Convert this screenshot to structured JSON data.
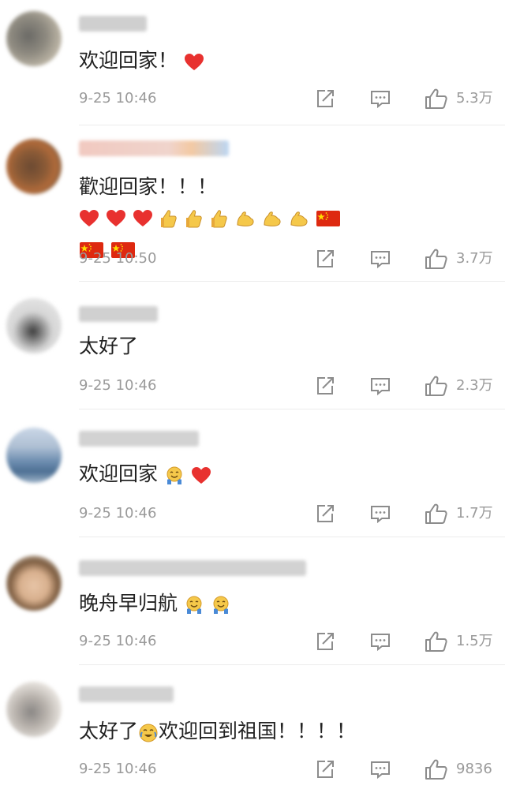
{
  "comments": [
    {
      "text": "欢迎回家！",
      "time": "9-25 10:46",
      "likes": "5.3万",
      "emoji": [
        "heart-icon"
      ]
    },
    {
      "text": "歡迎回家！！！",
      "time": "9-25 10:50",
      "likes": "3.7万",
      "emoji": [
        "heart-icon",
        "heart-icon",
        "heart-icon",
        "thumbs-up-icon",
        "thumbs-up-icon",
        "thumbs-up-icon",
        "flexed-biceps-icon",
        "flexed-biceps-icon",
        "flexed-biceps-icon",
        "china-flag-icon",
        "china-flag-icon",
        "china-flag-icon"
      ]
    },
    {
      "text": "太好了",
      "time": "9-25 10:46",
      "likes": "2.3万",
      "emoji": []
    },
    {
      "text": "欢迎回家",
      "time": "9-25 10:46",
      "likes": "1.7万",
      "emoji": [
        "crying-smile-icon",
        "heart-icon"
      ]
    },
    {
      "text": "晚舟早归航",
      "time": "9-25 10:46",
      "likes": "1.5万",
      "emoji": [
        "crying-smile-icon",
        "crying-smile-icon"
      ]
    },
    {
      "text_a": "太好了",
      "text_b": "欢迎回到祖国！！！！",
      "time": "9-25 10:46",
      "likes": "9836",
      "emoji": [
        "tears-of-joy-icon"
      ]
    }
  ],
  "colors": {
    "heart": "#e8312f",
    "flag_red": "#de2910",
    "flag_star": "#ffde00",
    "emoji_yellow": "#f5c84a",
    "meta_gray": "#9a9a9a",
    "icon_gray": "#8c8c8c"
  }
}
